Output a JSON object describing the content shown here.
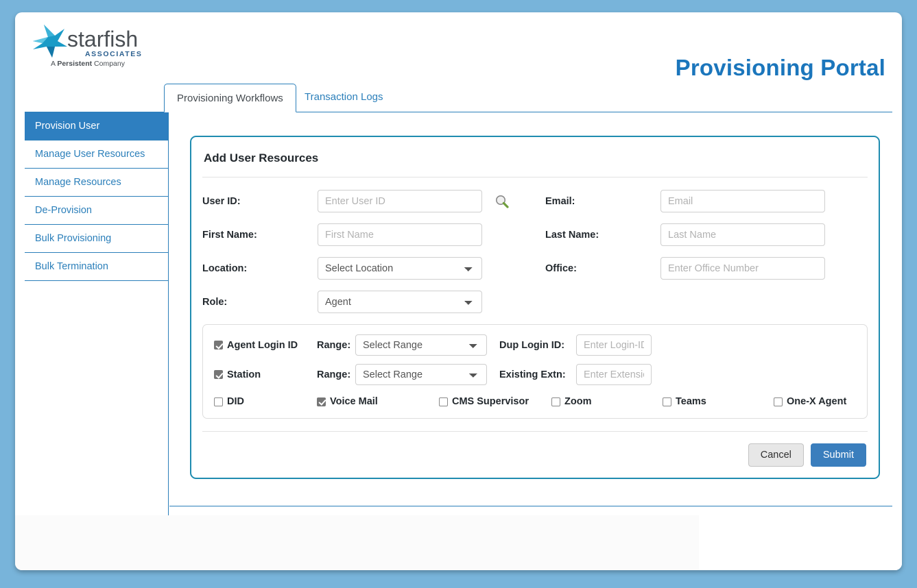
{
  "header": {
    "logo_name": "starfish",
    "logo_sub": "ASSOCIATES",
    "logo_tagline_pre": "A ",
    "logo_tagline_bold": "Persistent",
    "logo_tagline_post": " Company",
    "title": "Provisioning Portal",
    "accent_color": "#1b76bc"
  },
  "tabs": [
    {
      "label": "Provisioning Workflows",
      "active": true
    },
    {
      "label": "Transaction Logs",
      "active": false
    }
  ],
  "sidebar": {
    "items": [
      {
        "label": "Provision User",
        "active": true
      },
      {
        "label": "Manage User Resources",
        "active": false
      },
      {
        "label": "Manage Resources",
        "active": false
      },
      {
        "label": "De-Provision",
        "active": false
      },
      {
        "label": "Bulk Provisioning",
        "active": false
      },
      {
        "label": "Bulk Termination",
        "active": false
      }
    ],
    "active_bg": "#2e7fc0",
    "link_color": "#2b7fba"
  },
  "panel": {
    "title": "Add User Resources",
    "border_color": "#1f8cb0",
    "fields": {
      "user_id": {
        "label": "User ID:",
        "placeholder": "Enter User ID",
        "value": ""
      },
      "email": {
        "label": "Email:",
        "placeholder": "Email",
        "value": ""
      },
      "first_name": {
        "label": "First Name:",
        "placeholder": "First Name",
        "value": ""
      },
      "last_name": {
        "label": "Last Name:",
        "placeholder": "Last Name",
        "value": ""
      },
      "location": {
        "label": "Location:",
        "selected": "Select Location",
        "options": [
          "Select Location"
        ]
      },
      "office": {
        "label": "Office:",
        "placeholder": "Enter Office Number",
        "value": ""
      },
      "role": {
        "label": "Role:",
        "selected": "Agent",
        "options": [
          "Agent"
        ]
      }
    },
    "search_icon": "search-icon",
    "resources": {
      "agent_login": {
        "checkbox_label": "Agent Login ID",
        "checked": true,
        "range_label": "Range:",
        "range_selected": "Select Range",
        "range_options": [
          "Select Range"
        ],
        "extra_label": "Dup Login ID:",
        "extra_placeholder": "Enter Login-ID",
        "extra_value": ""
      },
      "station": {
        "checkbox_label": "Station",
        "checked": true,
        "range_label": "Range:",
        "range_selected": "Select Range",
        "range_options": [
          "Select Range"
        ],
        "extra_label": "Existing Extn:",
        "extra_placeholder": "Enter Extension",
        "extra_value": ""
      },
      "options": [
        {
          "label": "DID",
          "checked": false
        },
        {
          "label": "Voice Mail",
          "checked": true
        },
        {
          "label": "CMS Supervisor",
          "checked": false
        },
        {
          "label": "Zoom",
          "checked": false
        },
        {
          "label": "Teams",
          "checked": false
        },
        {
          "label": "One-X Agent",
          "checked": false
        }
      ]
    },
    "buttons": {
      "cancel": "Cancel",
      "submit": "Submit",
      "submit_color": "#3a7ebd"
    }
  }
}
